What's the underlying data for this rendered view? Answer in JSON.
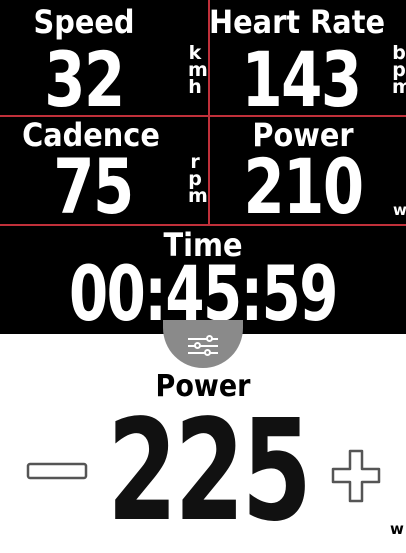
{
  "fields": [
    {
      "label": "Speed",
      "value": "32",
      "unit": "kmh"
    },
    {
      "label": "Heart Rate",
      "value": "143",
      "unit": "bpm"
    },
    {
      "label": "Cadence",
      "value": "75",
      "unit": "rpm"
    },
    {
      "label": "Power",
      "value": "210",
      "unit": "w"
    },
    {
      "label": "Time",
      "value": "00:45:59"
    }
  ],
  "editor": {
    "label": "Power",
    "value": "225",
    "unit": "w",
    "menu_icon": "sliders-icon",
    "decrease_icon": "minus-icon",
    "increase_icon": "plus-icon"
  },
  "colors": {
    "background": "#000000",
    "divider": "#c0303a",
    "text": "#ffffff",
    "menu_tab": "#8a8a8a"
  }
}
